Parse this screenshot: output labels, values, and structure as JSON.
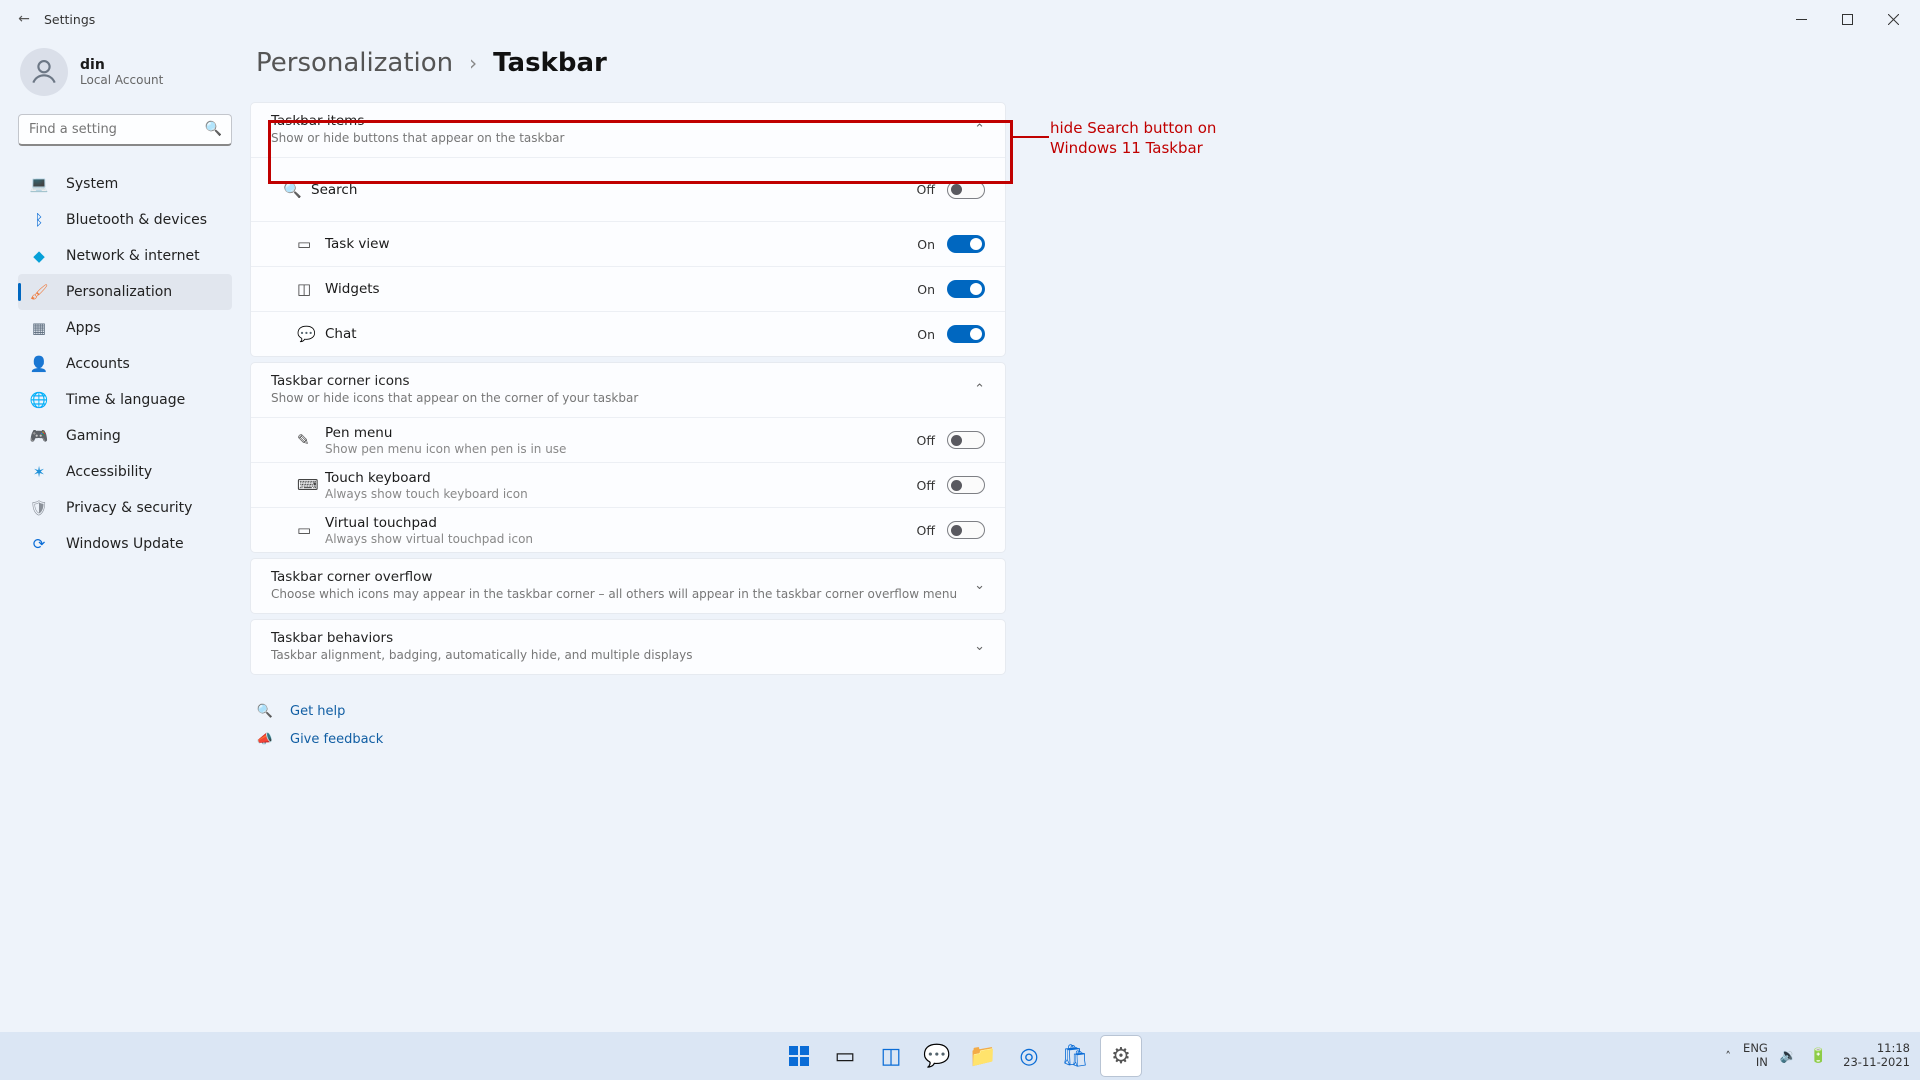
{
  "window": {
    "title": "Settings"
  },
  "user": {
    "name": "din",
    "type": "Local Account"
  },
  "search": {
    "placeholder": "Find a setting"
  },
  "nav": [
    {
      "label": "System",
      "icon": "💻",
      "color": "#0a6cd6"
    },
    {
      "label": "Bluetooth & devices",
      "icon": "ᛒ",
      "color": "#0a6cd6"
    },
    {
      "label": "Network & internet",
      "icon": "◆",
      "color": "#06a0d8"
    },
    {
      "label": "Personalization",
      "icon": "🖌",
      "color": "#ef7b3e",
      "active": true
    },
    {
      "label": "Apps",
      "icon": "▦",
      "color": "#5b6b7c"
    },
    {
      "label": "Accounts",
      "icon": "👤",
      "color": "#36b36a"
    },
    {
      "label": "Time & language",
      "icon": "🌐",
      "color": "#3c8fd4"
    },
    {
      "label": "Gaming",
      "icon": "🎮",
      "color": "#8a9099"
    },
    {
      "label": "Accessibility",
      "icon": "✶",
      "color": "#1e90d8"
    },
    {
      "label": "Privacy & security",
      "icon": "🛡",
      "color": "#8a9099"
    },
    {
      "label": "Windows Update",
      "icon": "⟳",
      "color": "#0a6cd6"
    }
  ],
  "breadcrumb": {
    "parent": "Personalization",
    "current": "Taskbar"
  },
  "sections": {
    "taskbar_items": {
      "title": "Taskbar items",
      "subtitle": "Show or hide buttons that appear on the taskbar",
      "rows": [
        {
          "label": "Search",
          "icon": "🔍",
          "state": "Off",
          "on": false
        },
        {
          "label": "Task view",
          "icon": "▭",
          "state": "On",
          "on": true
        },
        {
          "label": "Widgets",
          "icon": "◫",
          "state": "On",
          "on": true
        },
        {
          "label": "Chat",
          "icon": "💬",
          "state": "On",
          "on": true
        }
      ]
    },
    "corner_icons": {
      "title": "Taskbar corner icons",
      "subtitle": "Show or hide icons that appear on the corner of your taskbar",
      "rows": [
        {
          "label": "Pen menu",
          "sub": "Show pen menu icon when pen is in use",
          "icon": "✎",
          "state": "Off",
          "on": false
        },
        {
          "label": "Touch keyboard",
          "sub": "Always show touch keyboard icon",
          "icon": "⌨",
          "state": "Off",
          "on": false
        },
        {
          "label": "Virtual touchpad",
          "sub": "Always show virtual touchpad icon",
          "icon": "▭",
          "state": "Off",
          "on": false
        }
      ]
    },
    "overflow": {
      "title": "Taskbar corner overflow",
      "subtitle": "Choose which icons may appear in the taskbar corner – all others will appear in the taskbar corner overflow menu"
    },
    "behaviors": {
      "title": "Taskbar behaviors",
      "subtitle": "Taskbar alignment, badging, automatically hide, and multiple displays"
    }
  },
  "help": {
    "get_help": "Get help",
    "feedback": "Give feedback"
  },
  "annotation": {
    "text": "hide Search button on Windows 11 Taskbar"
  },
  "tray": {
    "lang1": "ENG",
    "lang2": "IN",
    "time": "11:18",
    "date": "23-11-2021"
  }
}
